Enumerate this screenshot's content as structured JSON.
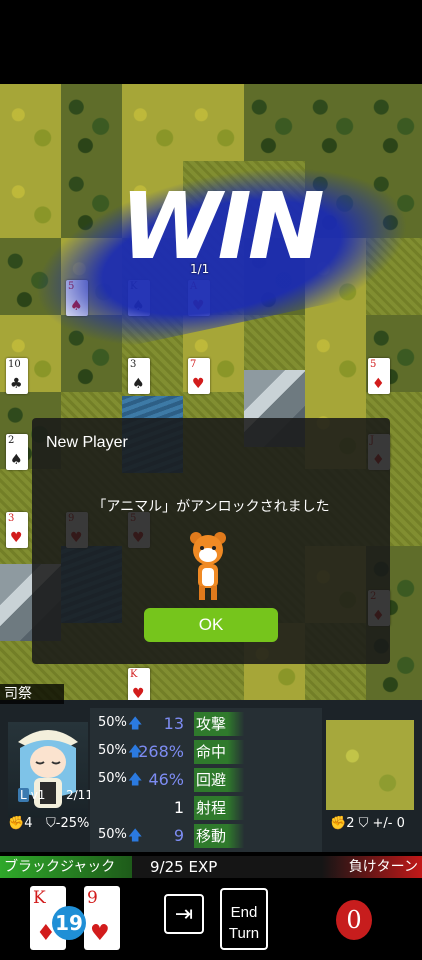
{
  "overlay": {
    "result": "WIN",
    "unit_hp_label": "1/1"
  },
  "board_cards": [
    {
      "rank": "5",
      "suit": "♠",
      "color": "red"
    },
    {
      "rank": "K",
      "suit": "♠",
      "color": "black"
    },
    {
      "rank": "A",
      "suit": "♥",
      "color": "red"
    },
    {
      "rank": "10",
      "suit": "♣",
      "color": "black"
    },
    {
      "rank": "3",
      "suit": "♠",
      "color": "black"
    },
    {
      "rank": "7",
      "suit": "♥",
      "color": "red"
    },
    {
      "rank": "5",
      "suit": "♦",
      "color": "red"
    },
    {
      "rank": "2",
      "suit": "♠",
      "color": "black"
    },
    {
      "rank": "3",
      "suit": "♥",
      "color": "red"
    },
    {
      "rank": "9",
      "suit": "♥",
      "color": "red"
    },
    {
      "rank": "5",
      "suit": "♥",
      "color": "red"
    },
    {
      "rank": "J",
      "suit": "♦",
      "color": "red"
    },
    {
      "rank": "2",
      "suit": "♦",
      "color": "red"
    },
    {
      "rank": "K",
      "suit": "♥",
      "color": "red"
    }
  ],
  "dialog": {
    "title": "New Player",
    "message": "「アニマル」がアンロックされました",
    "ok_label": "OK"
  },
  "unit": {
    "class_label": "司祭",
    "level_badge": "L",
    "level": "v1",
    "count": "2/11",
    "attack": "4",
    "defense": "-25%"
  },
  "stats": [
    {
      "percent": "50%",
      "value": "13",
      "name": "攻撃",
      "boosted": true
    },
    {
      "percent": "50%",
      "value": "268%",
      "name": "命中",
      "boosted": true
    },
    {
      "percent": "50%",
      "value": "46%",
      "name": "回避",
      "boosted": true
    },
    {
      "percent": "",
      "value": "1",
      "name": "射程",
      "boosted": false
    },
    {
      "percent": "50%",
      "value": "9",
      "name": "移動",
      "boosted": true
    }
  ],
  "terrain": {
    "attack": "2",
    "defense": "+/- 0"
  },
  "status_bar": {
    "game_mode": "ブラックジャック",
    "exp": "9/25",
    "exp_label": "EXP",
    "lose_turn": "負けターン"
  },
  "hand": {
    "cards": [
      {
        "rank": "K",
        "suit": "♦"
      },
      {
        "rank": "9",
        "suit": "♥"
      }
    ],
    "total": "19",
    "end_turn_line1": "End",
    "end_turn_line2": "Turn",
    "lose_count": "0"
  },
  "colors": {
    "win_brush": "#1b2bb2",
    "ok_button": "#76c51c",
    "boost_arrow": "#2b7ae0",
    "lose": "#c71d1d"
  }
}
